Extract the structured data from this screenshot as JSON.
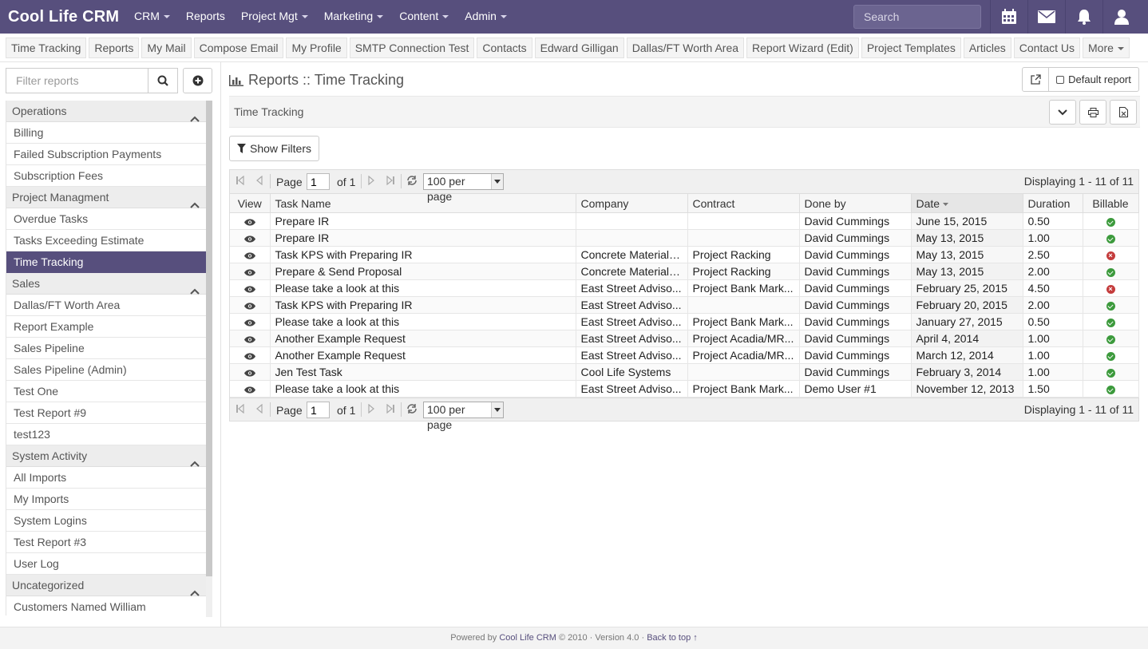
{
  "navbar": {
    "brand": "Cool Life CRM",
    "menu": [
      {
        "label": "CRM",
        "dropdown": true
      },
      {
        "label": "Reports",
        "dropdown": false
      },
      {
        "label": "Project Mgt",
        "dropdown": true
      },
      {
        "label": "Marketing",
        "dropdown": true
      },
      {
        "label": "Content",
        "dropdown": true
      },
      {
        "label": "Admin",
        "dropdown": true
      }
    ],
    "search_placeholder": "Search",
    "icons": [
      "calendar-icon",
      "mail-icon",
      "bell-icon",
      "user-icon"
    ]
  },
  "bookmarks": [
    "Time Tracking",
    "Reports",
    "My Mail",
    "Compose Email",
    "My Profile",
    "SMTP Connection Test",
    "Contacts",
    "Edward Gilligan",
    "Dallas/FT Worth Area",
    "Report Wizard (Edit)",
    "Project Templates",
    "Articles",
    "Contact Us",
    "More"
  ],
  "sidebar": {
    "filter_placeholder": "Filter reports",
    "groups": [
      {
        "name": "Operations",
        "items": [
          "Billing",
          "Failed Subscription Payments",
          "Subscription Fees"
        ]
      },
      {
        "name": "Project Managment",
        "items": [
          "Overdue Tasks",
          "Tasks Exceeding Estimate",
          "Time Tracking"
        ]
      },
      {
        "name": "Sales",
        "items": [
          "Dallas/FT Worth Area",
          "Report Example",
          "Sales Pipeline",
          "Sales Pipeline (Admin)",
          "Test One",
          "Test Report #9",
          "test123"
        ]
      },
      {
        "name": "System Activity",
        "items": [
          "All Imports",
          "My Imports",
          "System Logins",
          "Test Report #3",
          "User Log"
        ]
      },
      {
        "name": "Uncategorized",
        "items": [
          "Customers Named William"
        ]
      }
    ],
    "active_item": "Time Tracking"
  },
  "main": {
    "title": "Reports :: Time Tracking",
    "default_report_label": "Default report",
    "report_bar_title": "Time Tracking",
    "show_filters_label": "Show Filters"
  },
  "pager": {
    "page_label": "Page",
    "page_value": "1",
    "of_label": "of 1",
    "per_page": "100 per page",
    "display_text": "Displaying 1 - 11 of 11"
  },
  "table": {
    "columns": [
      "View",
      "Task Name",
      "Company",
      "Contract",
      "Done by",
      "Date",
      "Duration",
      "Billable"
    ],
    "rows": [
      {
        "task": "Prepare IR",
        "company": "",
        "contract": "",
        "done_by": "David Cummings",
        "date": "June 15, 2015",
        "duration": "0.50",
        "billable": true
      },
      {
        "task": "Prepare IR",
        "company": "",
        "contract": "",
        "done_by": "David Cummings",
        "date": "May 13, 2015",
        "duration": "1.00",
        "billable": true
      },
      {
        "task": "Task KPS with Preparing IR",
        "company": "Concrete Materials ...",
        "contract": "Project Racking",
        "done_by": "David Cummings",
        "date": "May 13, 2015",
        "duration": "2.50",
        "billable": false
      },
      {
        "task": "Prepare & Send Proposal",
        "company": "Concrete Materials ...",
        "contract": "Project Racking",
        "done_by": "David Cummings",
        "date": "May 13, 2015",
        "duration": "2.00",
        "billable": true
      },
      {
        "task": "Please take a look at this",
        "company": "East Street Adviso...",
        "contract": "Project Bank Mark...",
        "done_by": "David Cummings",
        "date": "February 25, 2015",
        "duration": "4.50",
        "billable": false
      },
      {
        "task": "Task KPS with Preparing IR",
        "company": "East Street Adviso...",
        "contract": "",
        "done_by": "David Cummings",
        "date": "February 20, 2015",
        "duration": "2.00",
        "billable": true
      },
      {
        "task": "Please take a look at this",
        "company": "East Street Adviso...",
        "contract": "Project Bank Mark...",
        "done_by": "David Cummings",
        "date": "January 27, 2015",
        "duration": "0.50",
        "billable": true
      },
      {
        "task": "Another Example Request",
        "company": "East Street Adviso...",
        "contract": "Project Acadia/MR...",
        "done_by": "David Cummings",
        "date": "April 4, 2014",
        "duration": "1.00",
        "billable": true
      },
      {
        "task": "Another Example Request",
        "company": "East Street Adviso...",
        "contract": "Project Acadia/MR...",
        "done_by": "David Cummings",
        "date": "March 12, 2014",
        "duration": "1.00",
        "billable": true
      },
      {
        "task": "Jen Test Task",
        "company": "Cool Life Systems",
        "contract": "",
        "done_by": "David Cummings",
        "date": "February 3, 2014",
        "duration": "1.00",
        "billable": true
      },
      {
        "task": "Please take a look at this",
        "company": "East Street Adviso...",
        "contract": "Project Bank Mark...",
        "done_by": "Demo User #1",
        "date": "November 12, 2013",
        "duration": "1.50",
        "billable": true
      }
    ]
  },
  "footer": {
    "prefix": "Powered by",
    "brand_link": "Cool Life CRM",
    "suffix": "© 2010 · Version 4.0 ·",
    "back_to_top": "Back to top ↑"
  },
  "colors": {
    "accent": "#574f7d",
    "billable_yes": "#3c9a3c",
    "billable_no": "#c43c3c"
  }
}
